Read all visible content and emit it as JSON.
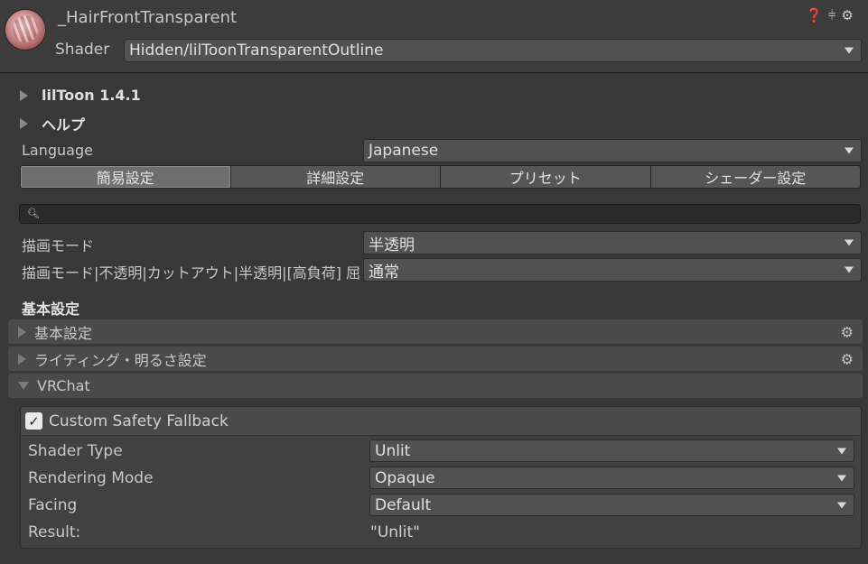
{
  "header": {
    "material_name": "_HairFrontTransparent",
    "shader_label": "Shader",
    "shader_value": "Hidden/lilToonTransparentOutline",
    "icons": [
      "help-icon",
      "preset-sliders-icon",
      "gear-icon"
    ]
  },
  "foldouts": {
    "version": "lilToon 1.4.1",
    "help": "ヘルプ"
  },
  "language": {
    "label": "Language",
    "value": "Japanese"
  },
  "tabs": [
    "簡易設定",
    "詳細設定",
    "プリセット",
    "シェーダー設定"
  ],
  "active_tab": 0,
  "search": {
    "placeholder": ""
  },
  "render_mode": {
    "label": "描画モード",
    "value": "半透明"
  },
  "render_mode_detail": {
    "label": "描画モード|不透明|カットアウト|半透明|[高負荷] 屈",
    "value": "通常"
  },
  "basic_section_title": "基本設定",
  "sections": [
    {
      "label": "基本設定",
      "expanded": false
    },
    {
      "label": "ライティング・明るさ設定",
      "expanded": false
    },
    {
      "label": "VRChat",
      "expanded": true
    }
  ],
  "vrchat": {
    "custom_fallback_label": "Custom Safety Fallback",
    "custom_fallback_checked": true,
    "shader_type": {
      "label": "Shader Type",
      "value": "Unlit"
    },
    "rendering_mode": {
      "label": "Rendering Mode",
      "value": "Opaque"
    },
    "facing": {
      "label": "Facing",
      "value": "Default"
    },
    "result": {
      "label": "Result:",
      "value": "\"Unlit\""
    }
  }
}
